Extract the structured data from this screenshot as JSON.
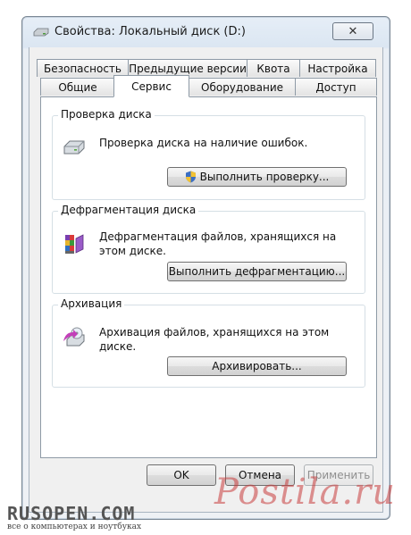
{
  "window": {
    "title": "Свойства: Локальный диск (D:)",
    "close_label": "✕"
  },
  "tabs_row1": [
    {
      "label": "Безопасность"
    },
    {
      "label": "Предыдущие версии"
    },
    {
      "label": "Квота"
    },
    {
      "label": "Настройка"
    }
  ],
  "tabs_row2": [
    {
      "label": "Общие"
    },
    {
      "label": "Сервис",
      "selected": true
    },
    {
      "label": "Оборудование"
    },
    {
      "label": "Доступ"
    }
  ],
  "groups": {
    "check": {
      "title": "Проверка диска",
      "text": "Проверка диска на наличие ошибок.",
      "button": "Выполнить проверку...",
      "icon": "hard-drive-icon"
    },
    "defrag": {
      "title": "Дефрагментация диска",
      "text": "Дефрагментация файлов, хранящихся на этом диске.",
      "button": "Выполнить дефрагментацию...",
      "icon": "defrag-icon"
    },
    "backup": {
      "title": "Архивация",
      "text": "Архивация файлов, хранящихся на этом диске.",
      "button": "Архивировать...",
      "icon": "backup-icon"
    }
  },
  "footer": {
    "ok": "OK",
    "cancel": "Отмена",
    "apply": "Применить"
  },
  "watermarks": {
    "left_logo": "RUSOPEN.COM",
    "left_sub": "все о компьютерах и ноутбуках",
    "right": "Postila.ru"
  }
}
